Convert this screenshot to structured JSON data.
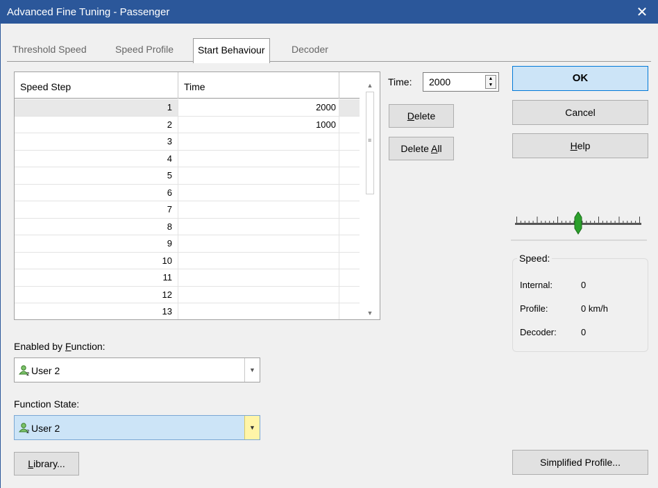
{
  "window": {
    "title": "Advanced Fine Tuning - Passenger",
    "close_icon": "✕"
  },
  "tabs": [
    {
      "label": "Threshold Speed"
    },
    {
      "label": "Speed Profile"
    },
    {
      "label": "Start Behaviour",
      "active": true
    },
    {
      "label": "Decoder"
    }
  ],
  "grid": {
    "columns": [
      "Speed Step",
      "Time"
    ],
    "rows": [
      {
        "step": "1",
        "time": "2000"
      },
      {
        "step": "2",
        "time": "1000"
      },
      {
        "step": "3",
        "time": ""
      },
      {
        "step": "4",
        "time": ""
      },
      {
        "step": "5",
        "time": ""
      },
      {
        "step": "6",
        "time": ""
      },
      {
        "step": "7",
        "time": ""
      },
      {
        "step": "8",
        "time": ""
      },
      {
        "step": "9",
        "time": ""
      },
      {
        "step": "10",
        "time": ""
      },
      {
        "step": "11",
        "time": ""
      },
      {
        "step": "12",
        "time": ""
      },
      {
        "step": "13",
        "time": ""
      }
    ],
    "selected_row": 0
  },
  "time_field": {
    "label": "Time:",
    "value": "2000"
  },
  "buttons": {
    "delete": {
      "mnemonic": "D",
      "rest": "elete"
    },
    "delete_all": {
      "prefix": "Delete ",
      "mnemonic": "A",
      "rest": "ll"
    },
    "ok": "OK",
    "cancel": "Cancel",
    "help": {
      "mnemonic": "H",
      "rest": "elp"
    },
    "simplified_profile": "Simplified Profile...",
    "library": {
      "mnemonic": "L",
      "rest": "ibrary..."
    }
  },
  "slider": {
    "level": 0.5
  },
  "speed": {
    "legend": "Speed:",
    "internal_label": "Internal:",
    "internal_value": "0",
    "profile_label": "Profile:",
    "profile_value": "0 km/h",
    "decoder_label": "Decoder:",
    "decoder_value": "0"
  },
  "enabled_by_function": {
    "label_prefix": "Enabled by ",
    "label_mnemonic": "F",
    "label_rest": "unction:",
    "value": "User 2",
    "icon": "user-2-icon"
  },
  "function_state": {
    "label": "Function State:",
    "value": "User 2",
    "icon": "user-2-icon"
  },
  "colors": {
    "titlebar": "#2b579a",
    "accent": "#0078d7",
    "highlight": "#cce4f7",
    "dropdown_highlight": "#fff5a8"
  }
}
